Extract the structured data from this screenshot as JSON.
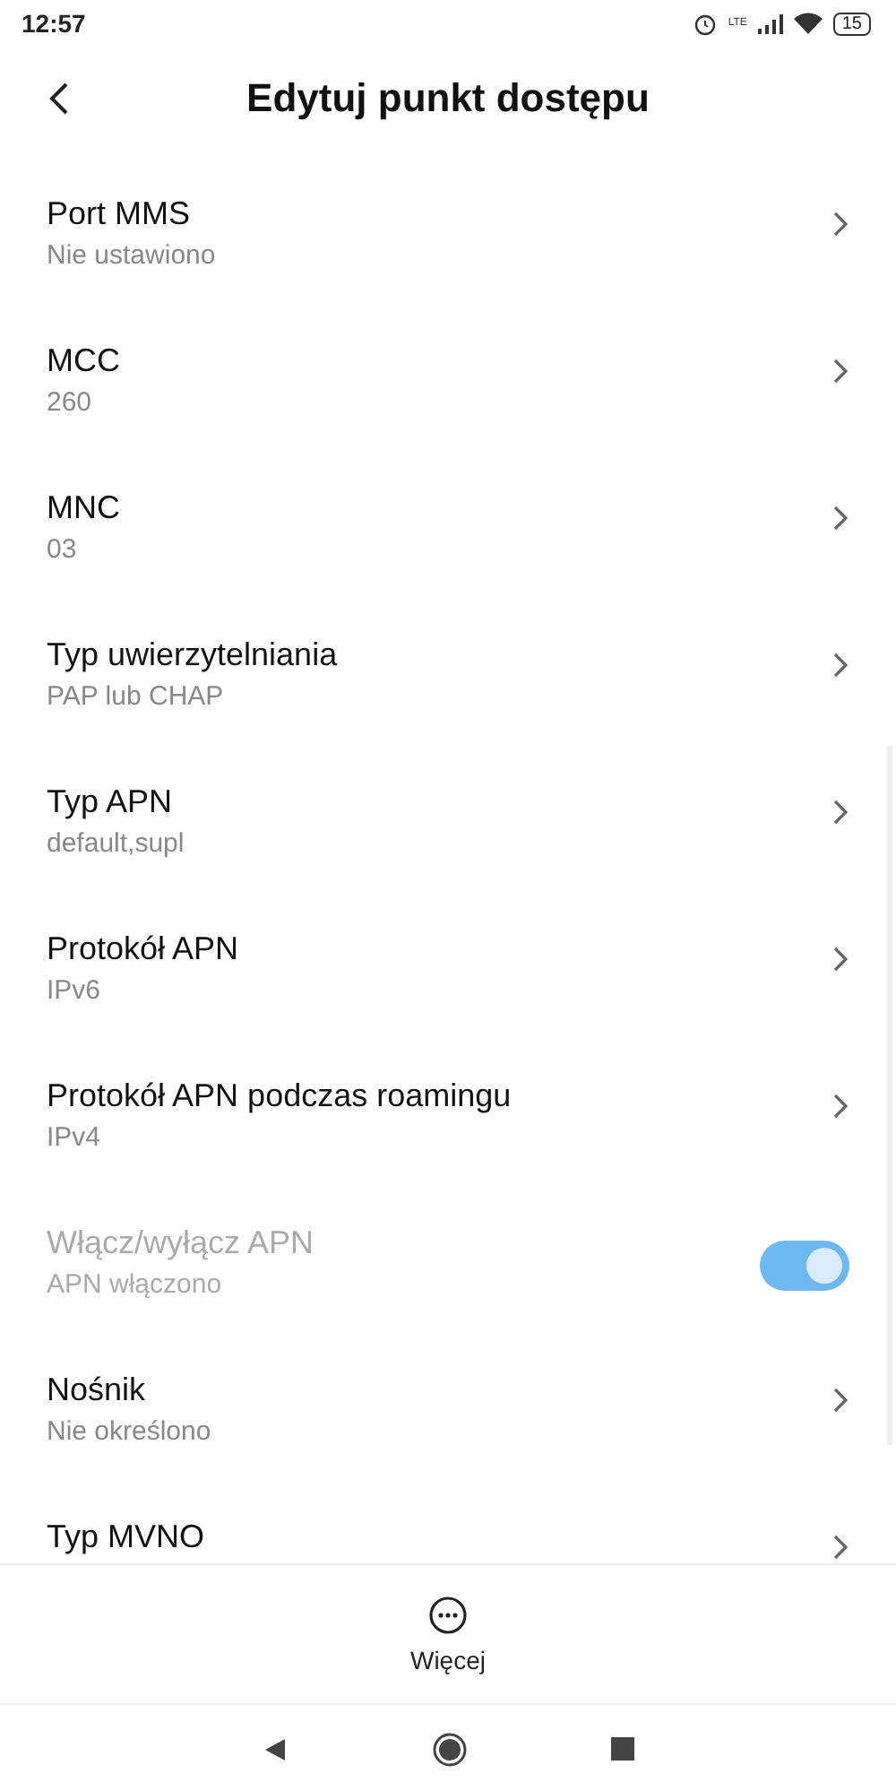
{
  "status_bar": {
    "time": "12:57",
    "network": "LTE",
    "battery": "15"
  },
  "header": {
    "title": "Edytuj punkt dostępu"
  },
  "items": [
    {
      "kind": "link",
      "title": "Port MMS",
      "summary": "Nie ustawiono"
    },
    {
      "kind": "link",
      "title": "MCC",
      "summary": "260"
    },
    {
      "kind": "link",
      "title": "MNC",
      "summary": "03"
    },
    {
      "kind": "link",
      "title": "Typ uwierzytelniania",
      "summary": "PAP lub CHAP"
    },
    {
      "kind": "link",
      "title": "Typ APN",
      "summary": "default,supl"
    },
    {
      "kind": "link",
      "title": "Protokół APN",
      "summary": "IPv6"
    },
    {
      "kind": "link",
      "title": "Protokół APN podczas roamingu",
      "summary": "IPv4"
    },
    {
      "kind": "toggle",
      "title": "Włącz/wyłącz APN",
      "summary": "APN włączono",
      "on": true,
      "disabled": true
    },
    {
      "kind": "link",
      "title": "Nośnik",
      "summary": "Nie określono"
    },
    {
      "kind": "link",
      "title": "Typ MVNO"
    }
  ],
  "bottom_action": {
    "label": "Więcej"
  }
}
